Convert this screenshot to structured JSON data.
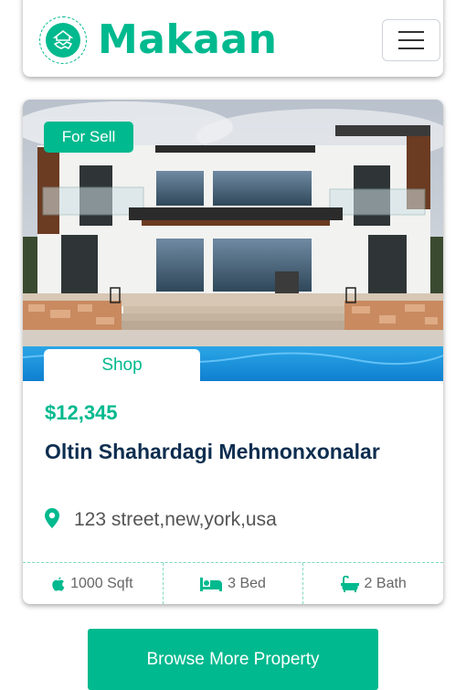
{
  "navbar": {
    "brand_name": "Makaan",
    "logo_icon": "handshake-house-icon",
    "menu_icon": "hamburger-menu-icon"
  },
  "property_card": {
    "status_badge": "For Sell",
    "type_badge": "Shop",
    "price": "$12,345",
    "title": "Oltin Shahardagi Mehmonxonalar",
    "address_icon": "map-marker-icon",
    "address": "123 street,new,york,usa",
    "stats": [
      {
        "icon": "area-icon",
        "label": "1000 Sqft"
      },
      {
        "icon": "bed-icon",
        "label": "3 Bed"
      },
      {
        "icon": "bath-icon",
        "label": "2 Bath"
      }
    ]
  },
  "browse_button": {
    "label": "Browse More Property"
  },
  "colors": {
    "accent": "#00b98e",
    "title": "#0e2e50",
    "text_muted": "#666666"
  }
}
